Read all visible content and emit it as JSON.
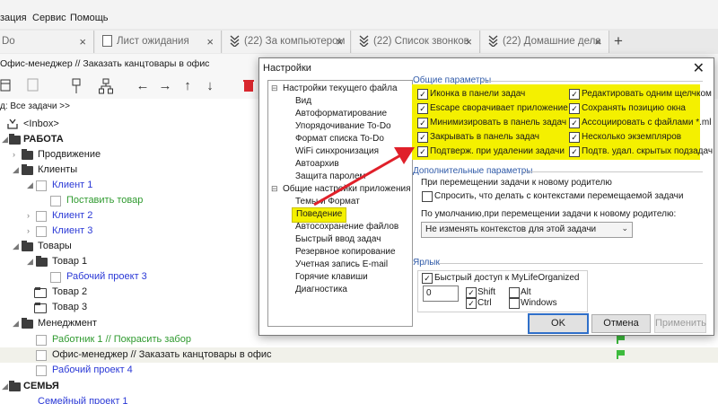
{
  "menubar": {
    "items": [
      "зация",
      "Сервис",
      "Помощь"
    ]
  },
  "tabs": [
    {
      "label": "Do"
    },
    {
      "label": "Лист ожидания"
    },
    {
      "label": "(22) За компьютером"
    },
    {
      "label": "(22) Список звонков"
    },
    {
      "label": "(22) Домашние дела"
    }
  ],
  "add_tab": "+",
  "breadcrumb": "Офис-менеджер // Заказать канцтовары в офис",
  "filter_label": "д: Все задачи >>",
  "tree": [
    {
      "text": "<Inbox>"
    },
    {
      "text": "РАБОТА"
    },
    {
      "text": "Продвижение"
    },
    {
      "text": "Клиенты"
    },
    {
      "text": "Клиент 1"
    },
    {
      "text": "Поставить товар"
    },
    {
      "text": "Клиент 2"
    },
    {
      "text": "Клиент 3"
    },
    {
      "text": "Товары"
    },
    {
      "text": "Товар 1"
    },
    {
      "text": "Рабочий проект 3"
    },
    {
      "text": "Товар 2"
    },
    {
      "text": "Товар 3"
    },
    {
      "text": "Менеджмент"
    },
    {
      "text": "Работник 1 // Покрасить забор"
    },
    {
      "text": "Офис-менеджер // Заказать канцтовары в офис"
    },
    {
      "text": "Рабочий проект 4"
    },
    {
      "text": "СЕМЬЯ"
    },
    {
      "text": "Семейный проект 1"
    }
  ],
  "colors": {
    "blue_task": "#2a38d6",
    "green_task": "#2f9a2f",
    "highlight": "#f4f000",
    "arrow": "#e0202a",
    "selected_row": "#f1f1ea"
  },
  "dialog": {
    "title": "Настройки",
    "close": "✕",
    "nav": {
      "file_settings": "Настройки текущего файла",
      "file_items": [
        "Вид",
        "Автоформатирование",
        "Упорядочивание To-Do",
        "Формат списка To-Do",
        "WiFi синхронизация",
        "Автоархив",
        "Защита паролем"
      ],
      "app_settings": "Общие настройки приложения",
      "app_items": [
        "Темы и Формат",
        "Поведение",
        "Автосохранение файлов",
        "Быстрый ввод задач",
        "Резервное копирование",
        "Учетная запись E-mail",
        "Горячие клавиши",
        "Диагностика"
      ]
    },
    "general": {
      "title": "Общие параметры",
      "left": [
        {
          "label": "Иконка в панели задач",
          "checked": true
        },
        {
          "label": "Escape сворачивает приложение",
          "checked": true
        },
        {
          "label": "Минимизировать в панель задач",
          "checked": true
        },
        {
          "label": "Закрывать в панель задач",
          "checked": true
        },
        {
          "label": "Подтверж. при удалении задачи",
          "checked": true
        }
      ],
      "right": [
        {
          "label": "Редактировать одним щелчком",
          "checked": true
        },
        {
          "label": "Сохранять позицию окна",
          "checked": true
        },
        {
          "label": "Ассоциировать с файлами *.ml",
          "checked": true
        },
        {
          "label": "Несколько экземпляров",
          "checked": true
        },
        {
          "label": "Подтв. удал. скрытых подзадач",
          "checked": true
        }
      ]
    },
    "additional": {
      "title": "Дополнительные параметры",
      "move_header": "При перемещении задачи к новому родителю",
      "ask_label": "Спросить, что делать с контекстами перемещаемой задачи",
      "ask_checked": false,
      "default_label": "По умолчанию,при перемещении задачи к новому родителю:",
      "select_value": "Не изменять контекстов для этой задачи"
    },
    "shortcut": {
      "title": "Ярлык",
      "quick_access": "Быстрый доступ к MyLifeOrganized",
      "quick_checked": true,
      "key_value": "0",
      "modifiers": [
        {
          "label": "Shift",
          "checked": true
        },
        {
          "label": "Alt",
          "checked": false
        },
        {
          "label": "Ctrl",
          "checked": true
        },
        {
          "label": "Windows",
          "checked": false
        }
      ]
    },
    "buttons": {
      "ok": "OK",
      "cancel": "Отмена",
      "apply": "Применить"
    }
  }
}
